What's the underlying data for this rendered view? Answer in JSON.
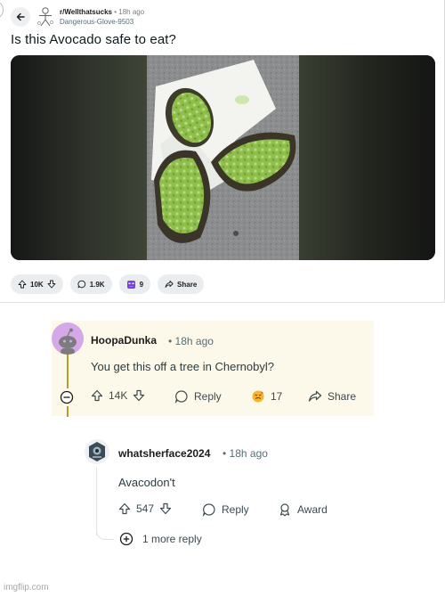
{
  "post": {
    "subreddit": "r/Wellthatsucks",
    "separator": "•",
    "time": "18h ago",
    "author": "Dangerous-Glove-9503",
    "title": "Is this Avocado safe to eat?"
  },
  "post_actions": {
    "upvotes": "10K",
    "comments": "1.9K",
    "awards": "9",
    "share_label": "Share"
  },
  "comment1": {
    "author": "HoopaDunka",
    "separator": "•",
    "time": "18h ago",
    "body": "You get this off a tree in Chernobyl?",
    "votes": "14K",
    "reply_label": "Reply",
    "award_count": "17",
    "share_label": "Share",
    "highlight_color": "#fdf9ea"
  },
  "comment2": {
    "author": "whatsherface2024",
    "separator": "•",
    "time": "18h ago",
    "body": "Avacodon't",
    "votes": "547",
    "reply_label": "Reply",
    "award_label": "Award"
  },
  "more_replies": "1 more reply",
  "watermark": "imgflip.com"
}
